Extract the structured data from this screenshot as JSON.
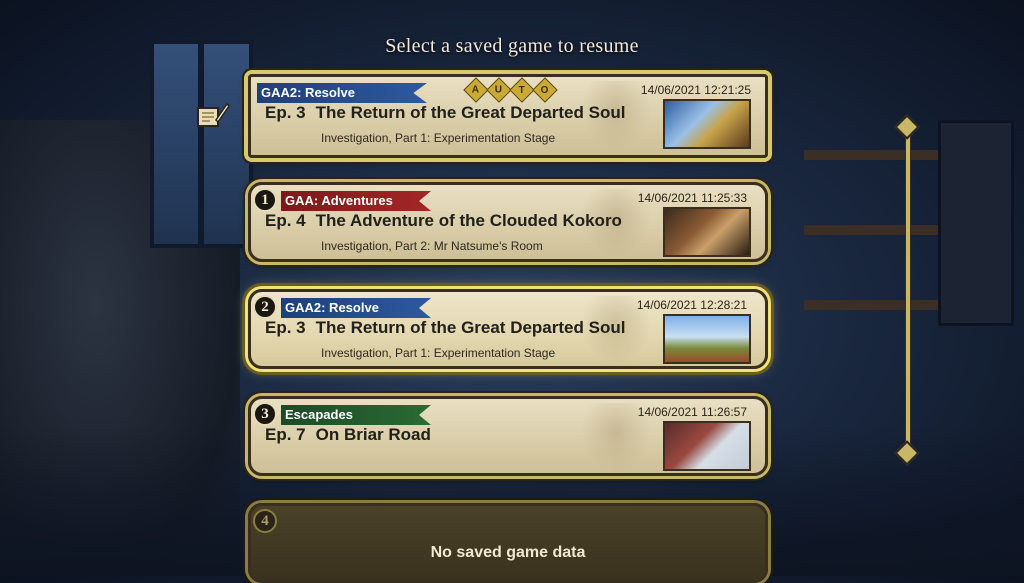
{
  "page_title": "Select a saved game to resume",
  "autosave": {
    "series": "GAA2: Resolve",
    "auto_label": [
      "A",
      "U",
      "T",
      "O"
    ],
    "timestamp": "14/06/2021 12:21:25",
    "episode_number": "Ep. 3",
    "episode_title": "The Return of the Great Departed Soul",
    "chapter": "Investigation, Part 1: Experimentation Stage",
    "ribbon_color": "#2c5aa0"
  },
  "slots": [
    {
      "badge": "1",
      "series": "GAA: Adventures",
      "timestamp": "14/06/2021 11:25:33",
      "episode_number": "Ep. 4",
      "episode_title": "The Adventure of the Clouded Kokoro",
      "chapter": "Investigation, Part 2: Mr Natsume's Room",
      "ribbon_color": "#a52626"
    },
    {
      "badge": "2",
      "series": "GAA2: Resolve",
      "timestamp": "14/06/2021 12:28:21",
      "episode_number": "Ep. 3",
      "episode_title": "The Return of the Great Departed Soul",
      "chapter": "Investigation, Part 1: Experimentation Stage",
      "ribbon_color": "#2c5aa0"
    },
    {
      "badge": "3",
      "series": "Escapades",
      "timestamp": "14/06/2021 11:26:57",
      "episode_number": "Ep. 7",
      "episode_title": "On Briar Road",
      "chapter": "",
      "ribbon_color": "#2a6b35"
    },
    {
      "badge": "4",
      "empty_label": "No saved game data"
    }
  ],
  "icons": {
    "memo": "memo-icon",
    "scroll_up": "chevron-up-icon",
    "scroll_down": "chevron-down-icon"
  }
}
